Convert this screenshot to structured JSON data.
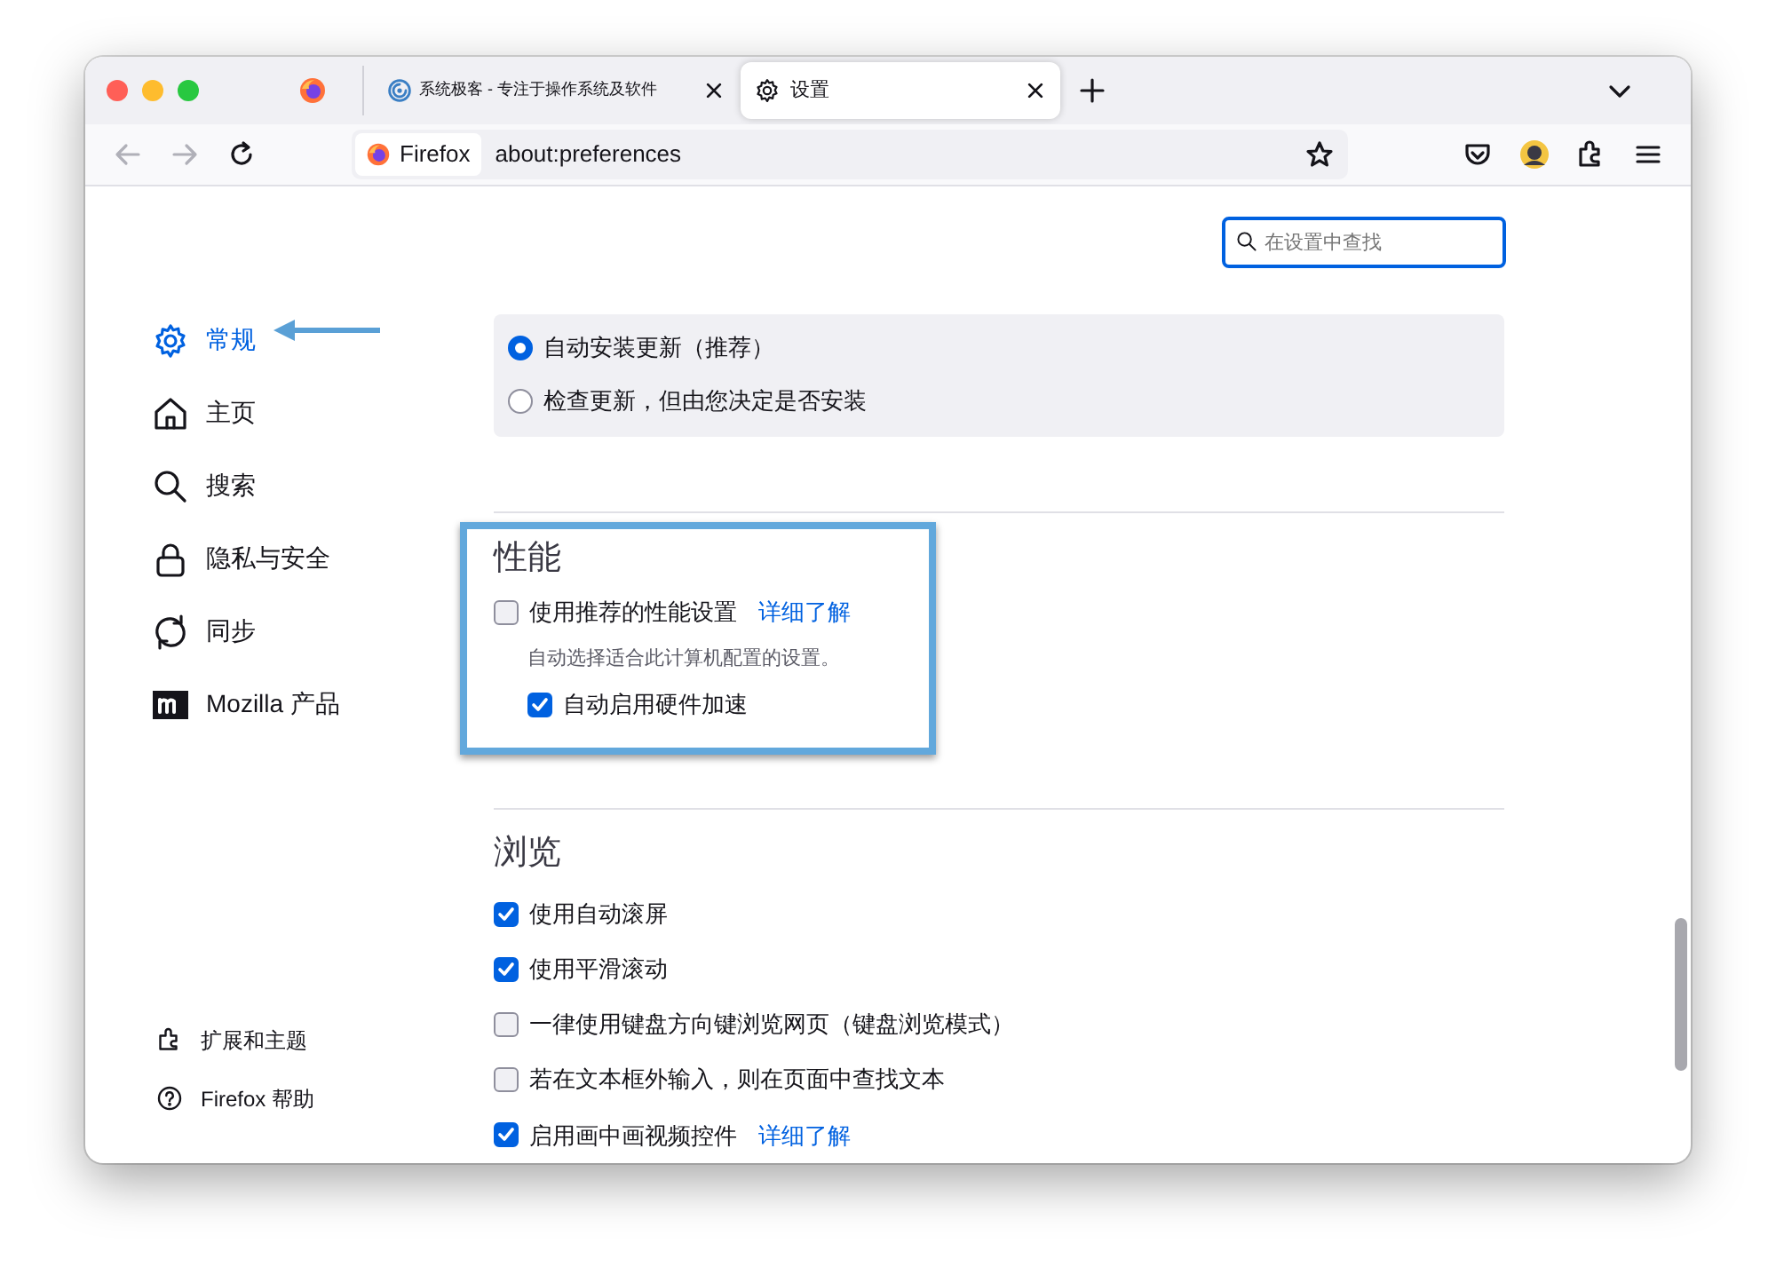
{
  "tabs": [
    {
      "kind": "pinned",
      "selected": false
    },
    {
      "kind": "site",
      "label": "系统极客 - 专注于操作系统及软件",
      "selected": false
    },
    {
      "kind": "settings",
      "label": "设置",
      "selected": true
    }
  ],
  "toolbar": {
    "identity": "Firefox",
    "url": "about:preferences"
  },
  "search": {
    "placeholder": "在设置中查找"
  },
  "sidebar": {
    "items": [
      {
        "kind": "gear",
        "label": "常规",
        "selected": true
      },
      {
        "kind": "home",
        "label": "主页",
        "selected": false
      },
      {
        "kind": "search",
        "label": "搜索",
        "selected": false
      },
      {
        "kind": "lock",
        "label": "隐私与安全",
        "selected": false
      },
      {
        "kind": "sync",
        "label": "同步",
        "selected": false
      },
      {
        "kind": "mozilla",
        "label": "Mozilla 产品",
        "selected": false
      }
    ],
    "footer": [
      {
        "kind": "puzzle",
        "label": "扩展和主题"
      },
      {
        "kind": "help",
        "label": "Firefox 帮助"
      }
    ]
  },
  "updates": [
    {
      "label": "自动安装更新（推荐）",
      "selected": true
    },
    {
      "label": "检查更新，但由您决定是否安装",
      "selected": false
    }
  ],
  "performance": {
    "heading": "性能",
    "recommended": {
      "label": "使用推荐的性能设置",
      "checked": false,
      "link": "详细了解",
      "description": "自动选择适合此计算机配置的设置。"
    },
    "hardware": {
      "label": "自动启用硬件加速",
      "checked": true
    }
  },
  "browsing": {
    "heading": "浏览",
    "items": [
      {
        "label": "使用自动滚屏",
        "checked": true
      },
      {
        "label": "使用平滑滚动",
        "checked": true
      },
      {
        "label": "一律使用键盘方向键浏览网页（键盘浏览模式）",
        "checked": false
      },
      {
        "label": "若在文本框外输入，则在页面中查找文本",
        "checked": false
      },
      {
        "label": "启用画中画视频控件",
        "checked": true,
        "link": "详细了解"
      }
    ]
  }
}
